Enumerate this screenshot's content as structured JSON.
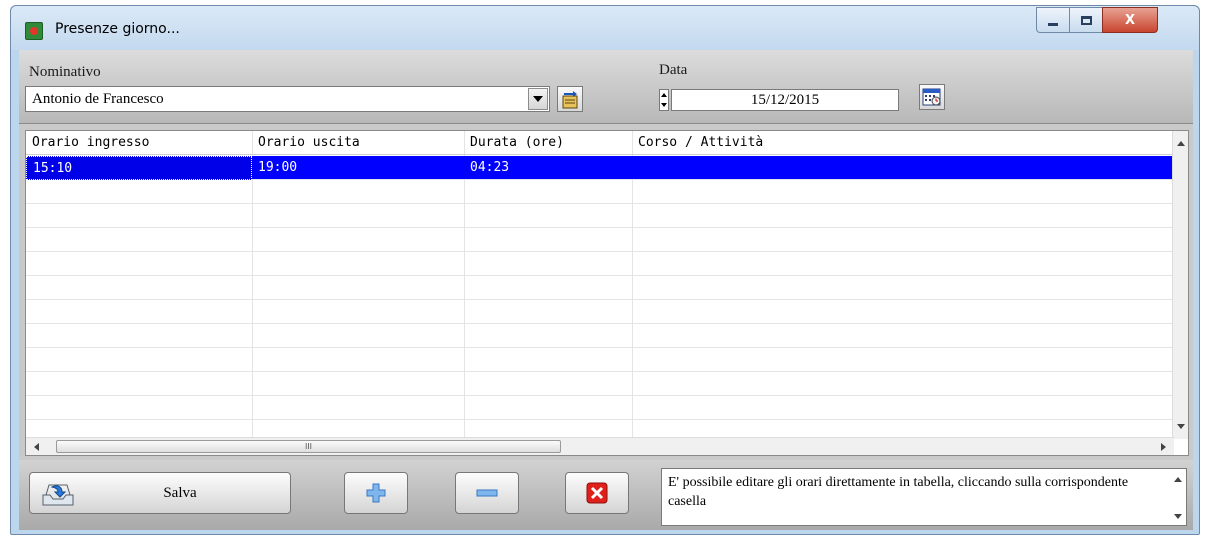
{
  "window": {
    "title": "Presenze giorno...",
    "controls": [
      "minimize-icon",
      "maximize-icon",
      "close-icon"
    ],
    "close_glyph": "X"
  },
  "form": {
    "nominativo_label": "Nominativo",
    "nominativo_value": "Antonio de Francesco",
    "data_label": "Data",
    "data_value": "15/12/2015"
  },
  "table": {
    "columns": [
      "Orario ingresso",
      "Orario uscita",
      "Durata (ore)",
      "Corso / Attività"
    ],
    "rows": [
      {
        "ingresso": "15:10",
        "uscita": "19:00",
        "durata": "04:23",
        "corso": "",
        "selected": true
      }
    ],
    "hscroll_grip": "III"
  },
  "toolbar": {
    "save_label": "Salva",
    "add_icon": "plus-icon",
    "remove_icon": "minus-icon",
    "delete_icon": "red-x-icon"
  },
  "info": {
    "message": "E' possibile editare gli orari direttamente in tabella, cliccando sulla corrispondente casella"
  },
  "colors": {
    "selection": "#0000ff",
    "window_frame": "#bcd6ee",
    "close_button": "#c8452f",
    "delete_icon": "#e0201a",
    "add_icon": "#4a8fd8"
  }
}
